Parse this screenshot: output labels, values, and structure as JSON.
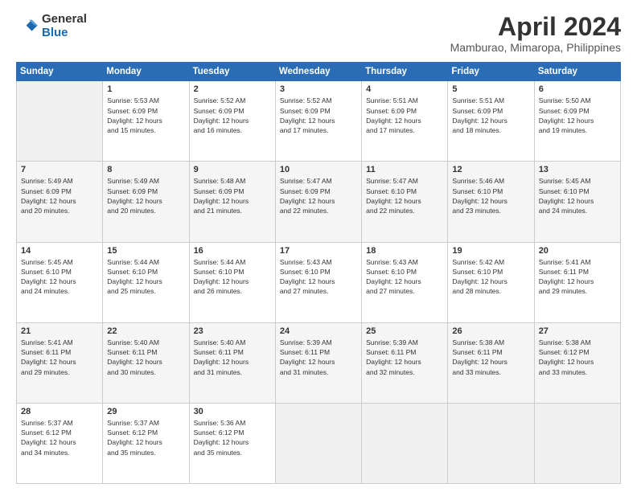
{
  "logo": {
    "general": "General",
    "blue": "Blue"
  },
  "title": "April 2024",
  "subtitle": "Mamburao, Mimaropa, Philippines",
  "weekdays": [
    "Sunday",
    "Monday",
    "Tuesday",
    "Wednesday",
    "Thursday",
    "Friday",
    "Saturday"
  ],
  "weeks": [
    [
      {
        "day": "",
        "info": ""
      },
      {
        "day": "1",
        "info": "Sunrise: 5:53 AM\nSunset: 6:09 PM\nDaylight: 12 hours\nand 15 minutes."
      },
      {
        "day": "2",
        "info": "Sunrise: 5:52 AM\nSunset: 6:09 PM\nDaylight: 12 hours\nand 16 minutes."
      },
      {
        "day": "3",
        "info": "Sunrise: 5:52 AM\nSunset: 6:09 PM\nDaylight: 12 hours\nand 17 minutes."
      },
      {
        "day": "4",
        "info": "Sunrise: 5:51 AM\nSunset: 6:09 PM\nDaylight: 12 hours\nand 17 minutes."
      },
      {
        "day": "5",
        "info": "Sunrise: 5:51 AM\nSunset: 6:09 PM\nDaylight: 12 hours\nand 18 minutes."
      },
      {
        "day": "6",
        "info": "Sunrise: 5:50 AM\nSunset: 6:09 PM\nDaylight: 12 hours\nand 19 minutes."
      }
    ],
    [
      {
        "day": "7",
        "info": "Sunrise: 5:49 AM\nSunset: 6:09 PM\nDaylight: 12 hours\nand 20 minutes."
      },
      {
        "day": "8",
        "info": "Sunrise: 5:49 AM\nSunset: 6:09 PM\nDaylight: 12 hours\nand 20 minutes."
      },
      {
        "day": "9",
        "info": "Sunrise: 5:48 AM\nSunset: 6:09 PM\nDaylight: 12 hours\nand 21 minutes."
      },
      {
        "day": "10",
        "info": "Sunrise: 5:47 AM\nSunset: 6:09 PM\nDaylight: 12 hours\nand 22 minutes."
      },
      {
        "day": "11",
        "info": "Sunrise: 5:47 AM\nSunset: 6:10 PM\nDaylight: 12 hours\nand 22 minutes."
      },
      {
        "day": "12",
        "info": "Sunrise: 5:46 AM\nSunset: 6:10 PM\nDaylight: 12 hours\nand 23 minutes."
      },
      {
        "day": "13",
        "info": "Sunrise: 5:45 AM\nSunset: 6:10 PM\nDaylight: 12 hours\nand 24 minutes."
      }
    ],
    [
      {
        "day": "14",
        "info": "Sunrise: 5:45 AM\nSunset: 6:10 PM\nDaylight: 12 hours\nand 24 minutes."
      },
      {
        "day": "15",
        "info": "Sunrise: 5:44 AM\nSunset: 6:10 PM\nDaylight: 12 hours\nand 25 minutes."
      },
      {
        "day": "16",
        "info": "Sunrise: 5:44 AM\nSunset: 6:10 PM\nDaylight: 12 hours\nand 26 minutes."
      },
      {
        "day": "17",
        "info": "Sunrise: 5:43 AM\nSunset: 6:10 PM\nDaylight: 12 hours\nand 27 minutes."
      },
      {
        "day": "18",
        "info": "Sunrise: 5:43 AM\nSunset: 6:10 PM\nDaylight: 12 hours\nand 27 minutes."
      },
      {
        "day": "19",
        "info": "Sunrise: 5:42 AM\nSunset: 6:10 PM\nDaylight: 12 hours\nand 28 minutes."
      },
      {
        "day": "20",
        "info": "Sunrise: 5:41 AM\nSunset: 6:11 PM\nDaylight: 12 hours\nand 29 minutes."
      }
    ],
    [
      {
        "day": "21",
        "info": "Sunrise: 5:41 AM\nSunset: 6:11 PM\nDaylight: 12 hours\nand 29 minutes."
      },
      {
        "day": "22",
        "info": "Sunrise: 5:40 AM\nSunset: 6:11 PM\nDaylight: 12 hours\nand 30 minutes."
      },
      {
        "day": "23",
        "info": "Sunrise: 5:40 AM\nSunset: 6:11 PM\nDaylight: 12 hours\nand 31 minutes."
      },
      {
        "day": "24",
        "info": "Sunrise: 5:39 AM\nSunset: 6:11 PM\nDaylight: 12 hours\nand 31 minutes."
      },
      {
        "day": "25",
        "info": "Sunrise: 5:39 AM\nSunset: 6:11 PM\nDaylight: 12 hours\nand 32 minutes."
      },
      {
        "day": "26",
        "info": "Sunrise: 5:38 AM\nSunset: 6:11 PM\nDaylight: 12 hours\nand 33 minutes."
      },
      {
        "day": "27",
        "info": "Sunrise: 5:38 AM\nSunset: 6:12 PM\nDaylight: 12 hours\nand 33 minutes."
      }
    ],
    [
      {
        "day": "28",
        "info": "Sunrise: 5:37 AM\nSunset: 6:12 PM\nDaylight: 12 hours\nand 34 minutes."
      },
      {
        "day": "29",
        "info": "Sunrise: 5:37 AM\nSunset: 6:12 PM\nDaylight: 12 hours\nand 35 minutes."
      },
      {
        "day": "30",
        "info": "Sunrise: 5:36 AM\nSunset: 6:12 PM\nDaylight: 12 hours\nand 35 minutes."
      },
      {
        "day": "",
        "info": ""
      },
      {
        "day": "",
        "info": ""
      },
      {
        "day": "",
        "info": ""
      },
      {
        "day": "",
        "info": ""
      }
    ]
  ]
}
